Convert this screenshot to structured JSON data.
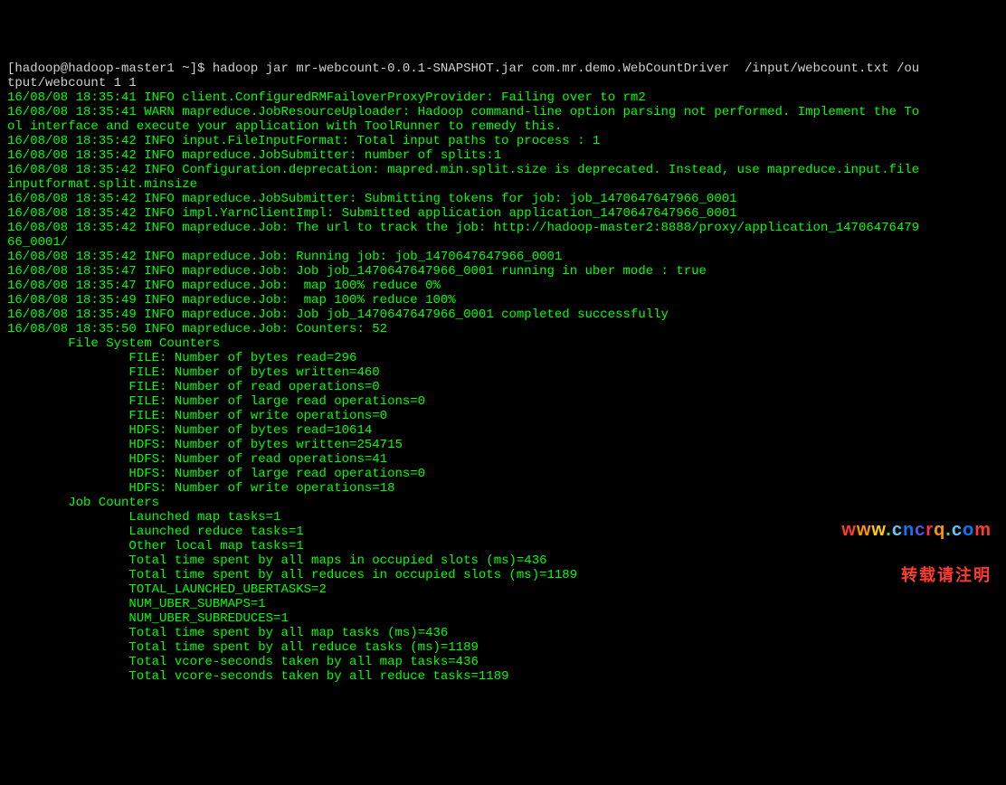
{
  "prompt": "[hadoop@hadoop-master1 ~]$ ",
  "command": "hadoop jar mr-webcount-0.0.1-SNAPSHOT.jar com.mr.demo.WebCountDriver  /input/webcount.txt /output/webcount 1 1",
  "lines": [
    "16/08/08 18:35:41 INFO client.ConfiguredRMFailoverProxyProvider: Failing over to rm2",
    "16/08/08 18:35:41 WARN mapreduce.JobResourceUploader: Hadoop command-line option parsing not performed. Implement the Tool interface and execute your application with ToolRunner to remedy this.",
    "16/08/08 18:35:42 INFO input.FileInputFormat: Total input paths to process : 1",
    "16/08/08 18:35:42 INFO mapreduce.JobSubmitter: number of splits:1",
    "16/08/08 18:35:42 INFO Configuration.deprecation: mapred.min.split.size is deprecated. Instead, use mapreduce.input.fileinputformat.split.minsize",
    "16/08/08 18:35:42 INFO mapreduce.JobSubmitter: Submitting tokens for job: job_1470647647966_0001",
    "16/08/08 18:35:42 INFO impl.YarnClientImpl: Submitted application application_1470647647966_0001",
    "16/08/08 18:35:42 INFO mapreduce.Job: The url to track the job: http://hadoop-master2:8888/proxy/application_1470647647966_0001/",
    "16/08/08 18:35:42 INFO mapreduce.Job: Running job: job_1470647647966_0001",
    "16/08/08 18:35:47 INFO mapreduce.Job: Job job_1470647647966_0001 running in uber mode : true",
    "16/08/08 18:35:47 INFO mapreduce.Job:  map 100% reduce 0%",
    "16/08/08 18:35:49 INFO mapreduce.Job:  map 100% reduce 100%",
    "16/08/08 18:35:49 INFO mapreduce.Job: Job job_1470647647966_0001 completed successfully",
    "16/08/08 18:35:50 INFO mapreduce.Job: Counters: 52",
    "        File System Counters",
    "                FILE: Number of bytes read=296",
    "                FILE: Number of bytes written=460",
    "                FILE: Number of read operations=0",
    "                FILE: Number of large read operations=0",
    "                FILE: Number of write operations=0",
    "                HDFS: Number of bytes read=10614",
    "                HDFS: Number of bytes written=254715",
    "                HDFS: Number of read operations=41",
    "                HDFS: Number of large read operations=0",
    "                HDFS: Number of write operations=18",
    "        Job Counters ",
    "                Launched map tasks=1",
    "                Launched reduce tasks=1",
    "                Other local map tasks=1",
    "                Total time spent by all maps in occupied slots (ms)=436",
    "                Total time spent by all reduces in occupied slots (ms)=1189",
    "                TOTAL_LAUNCHED_UBERTASKS=2",
    "                NUM_UBER_SUBMAPS=1",
    "                NUM_UBER_SUBREDUCES=1",
    "                Total time spent by all map tasks (ms)=436",
    "                Total time spent by all reduce tasks (ms)=1189",
    "                Total vcore-seconds taken by all map tasks=436",
    "                Total vcore-seconds taken by all reduce tasks=1189"
  ],
  "watermark": {
    "url": "www.cncrq.com",
    "tag": "转载请注明"
  }
}
